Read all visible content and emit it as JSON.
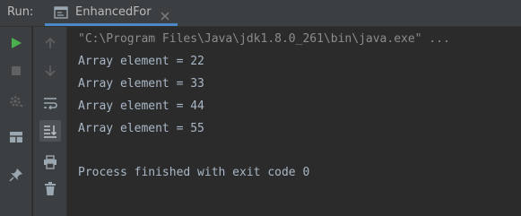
{
  "run_panel": {
    "label": "Run:",
    "tab_title": "EnhancedFor"
  },
  "console": {
    "command_line": "\"C:\\Program Files\\Java\\jdk1.8.0_261\\bin\\java.exe\" ...",
    "output_lines": [
      "Array element = 22",
      "Array element = 33",
      "Array element = 44",
      "Array element = 55"
    ],
    "exit_message": "Process finished with exit code 0"
  },
  "icons": {
    "tab": "console-window-icon",
    "tab_close": "close-icon",
    "rerun": "rerun-play-icon",
    "stop": "stop-icon",
    "settings": "settings-icon",
    "layout": "layout-icon",
    "pin": "pin-icon",
    "up": "arrow-up-icon",
    "down": "arrow-down-icon",
    "soft_wrap": "soft-wrap-icon",
    "scroll_end": "scroll-to-end-icon",
    "print": "print-icon",
    "clear": "trash-icon"
  },
  "colors": {
    "run_green": "#4caf50",
    "console_text": "#a9b7c6",
    "command_text": "#8c8c8c",
    "panel_bg": "#3c3f41",
    "console_bg": "#2b2b2b",
    "tab_underline": "#4a88c7"
  }
}
